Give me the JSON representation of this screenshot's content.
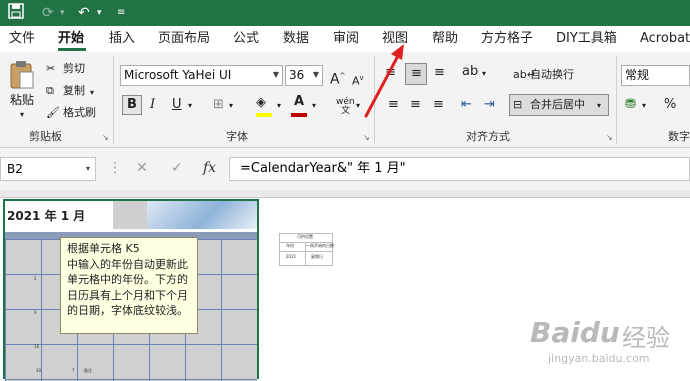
{
  "qat": {
    "save_icon": "save-icon",
    "redo_icon": "redo-icon",
    "undo_icon": "undo-icon",
    "customize_icon": "customize-icon"
  },
  "tabs": [
    "文件",
    "开始",
    "插入",
    "页面布局",
    "公式",
    "数据",
    "审阅",
    "视图",
    "帮助",
    "方方格子",
    "DIY工具箱",
    "Acrobat"
  ],
  "clipboard": {
    "paste": "粘贴",
    "cut": "剪切",
    "copy": "复制",
    "format_painter": "格式刷",
    "group": "剪贴板"
  },
  "font": {
    "name": "Microsoft YaHei UI",
    "size": "36",
    "grow": "A",
    "shrink": "A",
    "bold": "B",
    "italic": "I",
    "underline": "U",
    "font_color": "A",
    "phonetic": "wén",
    "phonetic_sub": "文",
    "group": "字体"
  },
  "alignment": {
    "wrap": "自动换行",
    "merge": "合并后居中",
    "group": "对齐方式"
  },
  "number": {
    "format": "常规",
    "percent": "%",
    "group": "数字"
  },
  "formula_bar": {
    "name_box": "B2",
    "fx": "fx",
    "formula": "=CalendarYear&\" 年 1 月\""
  },
  "calendar": {
    "title": "2021 年 1 月",
    "day_numbers": [
      "2",
      "9",
      "16",
      "23",
      "30",
      "7"
    ],
    "last_row_text": "备注"
  },
  "side_table": {
    "title": "可供设置",
    "label1": "年份",
    "value1": "一周开始的日期",
    "label2": "2021",
    "value2": "星期日"
  },
  "tooltip": {
    "lines": [
      "根据单元格 K5",
      "中输入的年份自动更新此",
      "单元格中的年份。下方的",
      "日历具有上个月和下个月",
      "的日期，字体底纹较浅。"
    ]
  },
  "watermark": {
    "brand": "Baidu",
    "cn": "经验",
    "url": "jingyan.baidu.com"
  },
  "colors": {
    "excel_green": "#217346",
    "arrow_red": "#e02020",
    "tooltip_bg": "#ffffe1",
    "font_color_bar": "#c00000",
    "fill_color_bar": "#ffff00"
  }
}
